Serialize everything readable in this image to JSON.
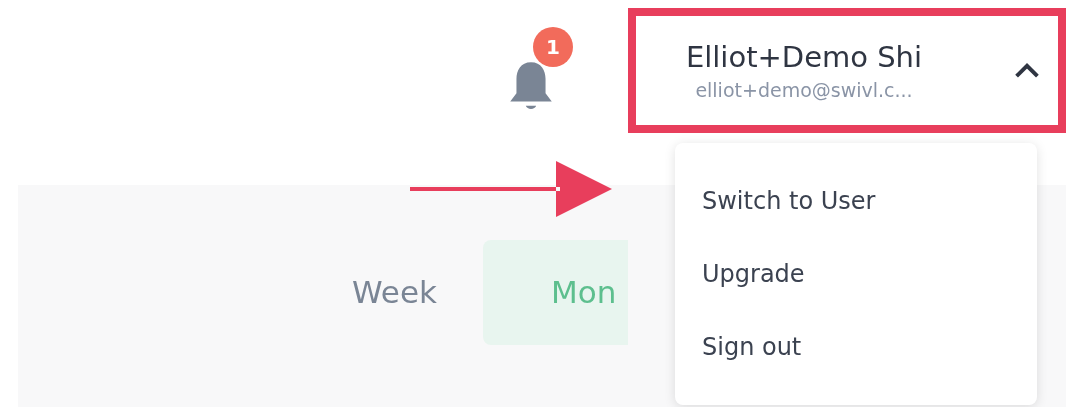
{
  "notifications": {
    "count": "1"
  },
  "account": {
    "name": "Elliot+Demo Shi",
    "email": "elliot+demo@swivl.c...",
    "expanded": true
  },
  "tabs": [
    {
      "label": "Week",
      "selected": false
    },
    {
      "label": "Mon",
      "selected": true
    }
  ],
  "menu": {
    "items": [
      "Switch to User",
      "Upgrade",
      "Sign out"
    ]
  }
}
